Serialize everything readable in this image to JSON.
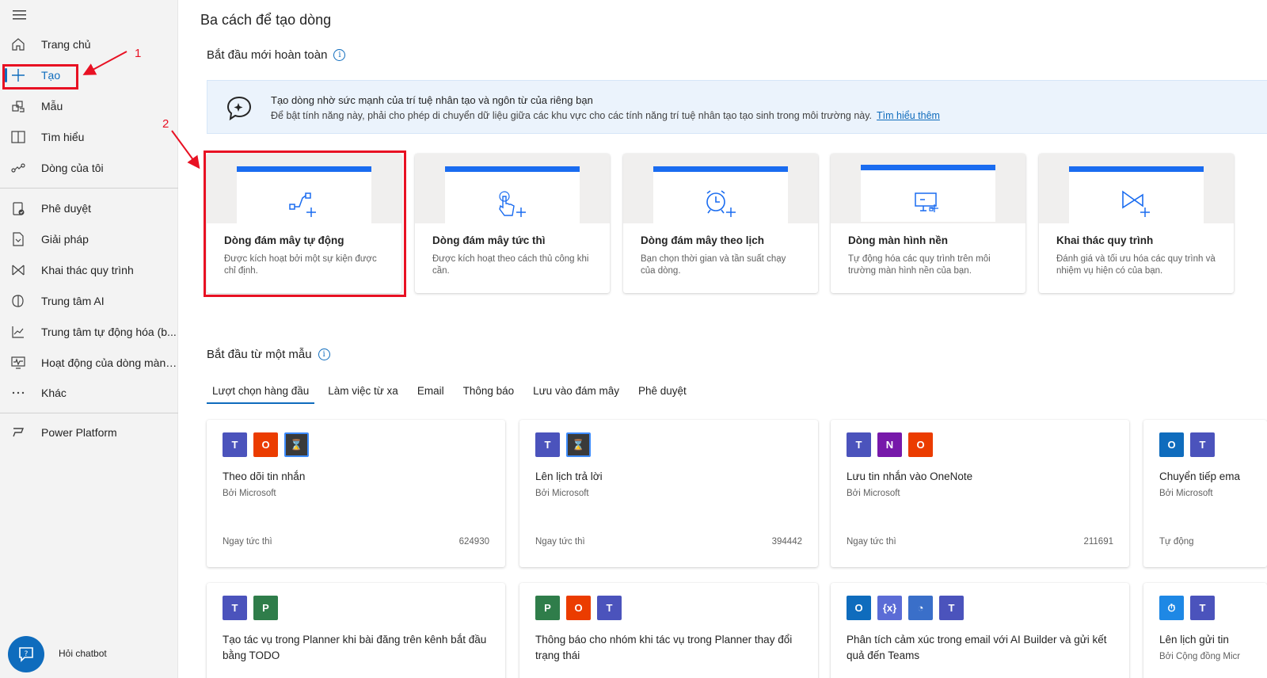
{
  "sidebar": {
    "items": [
      {
        "label": "Trang chủ"
      },
      {
        "label": "Tạo"
      },
      {
        "label": "Mẫu"
      },
      {
        "label": "Tìm hiểu"
      },
      {
        "label": "Dòng của tôi"
      },
      {
        "label": "Phê duyệt"
      },
      {
        "label": "Giải pháp"
      },
      {
        "label": "Khai thác quy trình"
      },
      {
        "label": "Trung tâm AI"
      },
      {
        "label": "Trung tâm tự động hóa (b..."
      },
      {
        "label": "Hoạt động của dòng màn ..."
      },
      {
        "label": "Khác"
      },
      {
        "label": "Power Platform"
      }
    ],
    "chatbot_label": "Hỏi chatbot"
  },
  "annotations": {
    "one": "1",
    "two": "2",
    "color": "#e81123"
  },
  "main": {
    "title": "Ba cách để tạo dòng",
    "section1": "Bắt đầu mới hoàn toàn",
    "section2": "Bắt đầu từ một mẫu",
    "info_glyph": "i",
    "banner": {
      "title": "Tạo dòng nhờ sức mạnh của trí tuệ nhân tạo và ngôn từ của riêng bạn",
      "text": "Để bật tính năng này, phải cho phép di chuyển dữ liệu giữa các khu vực cho các tính năng trí tuệ nhân tạo tạo sinh trong môi trường này.",
      "link": "Tìm hiểu thêm"
    },
    "flow_types": [
      {
        "title": "Dòng đám mây tự động",
        "desc": "Được kích hoạt bởi một sự kiện được chỉ định.",
        "icon": "automated-flow-icon"
      },
      {
        "title": "Dòng đám mây tức thì",
        "desc": "Được kích hoạt theo cách thủ công khi cần.",
        "icon": "instant-flow-icon"
      },
      {
        "title": "Dòng đám mây theo lịch",
        "desc": "Bạn chọn thời gian và tần suất chạy của dòng.",
        "icon": "scheduled-flow-icon"
      },
      {
        "title": "Dòng màn hình nền",
        "desc": "Tự động hóa các quy trình trên môi trường màn hình nền của bạn.",
        "icon": "desktop-flow-icon"
      },
      {
        "title": "Khai thác quy trình",
        "desc": "Đánh giá và tối ưu hóa các quy trình và nhiệm vụ hiện có của bạn.",
        "icon": "process-mining-icon"
      }
    ],
    "tabs": [
      "Lượt chọn hàng đầu",
      "Làm việc từ xa",
      "Email",
      "Thông báo",
      "Lưu vào đám mây",
      "Phê duyệt"
    ],
    "templates": [
      {
        "title": "Theo dõi tin nhắn",
        "by": "Bởi Microsoft",
        "type": "Ngay tức thì",
        "count": "624930",
        "icons": [
          "teams-icon",
          "office-icon",
          "delay-icon"
        ]
      },
      {
        "title": "Lên lịch trả lời",
        "by": "Bởi Microsoft",
        "type": "Ngay tức thì",
        "count": "394442",
        "icons": [
          "teams-icon",
          "delay-icon"
        ]
      },
      {
        "title": "Lưu tin nhắn vào OneNote",
        "by": "Bởi Microsoft",
        "type": "Ngay tức thì",
        "count": "211691",
        "icons": [
          "teams-icon",
          "onenote-icon",
          "office-icon"
        ]
      },
      {
        "title": "Chuyển tiếp ema",
        "by": "Bởi Microsoft",
        "type": "Tự động",
        "count": "",
        "icons": [
          "outlook-icon",
          "teams-icon"
        ]
      },
      {
        "title": "Tạo tác vụ trong Planner khi bài đăng trên kênh bắt đầu bằng TODO",
        "by": "",
        "type": "",
        "count": "",
        "icons": [
          "teams-icon",
          "planner-icon"
        ]
      },
      {
        "title": "Thông báo cho nhóm khi tác vụ trong Planner thay đổi trạng thái",
        "by": "",
        "type": "",
        "count": "",
        "icons": [
          "planner-icon",
          "office-icon",
          "teams-icon"
        ]
      },
      {
        "title": "Phân tích cảm xúc trong email với AI Builder và gửi kết quả đến Teams",
        "by": "",
        "type": "",
        "count": "",
        "icons": [
          "outlook-icon",
          "variable-icon",
          "ai-builder-icon",
          "teams-icon"
        ]
      },
      {
        "title": "Lên lịch gửi tin",
        "by": "Bởi Cộng đồng Micr",
        "type": "",
        "count": "",
        "icons": [
          "clock-icon",
          "teams-icon"
        ]
      }
    ]
  },
  "colors": {
    "accent": "#0f6cbd",
    "card_bar": "#1a6cf0",
    "teams": "#4b53bc",
    "office": "#eb3c00",
    "planner": "#2f7d4a",
    "onenote": "#7719aa",
    "outlook": "#0f6cbd"
  }
}
